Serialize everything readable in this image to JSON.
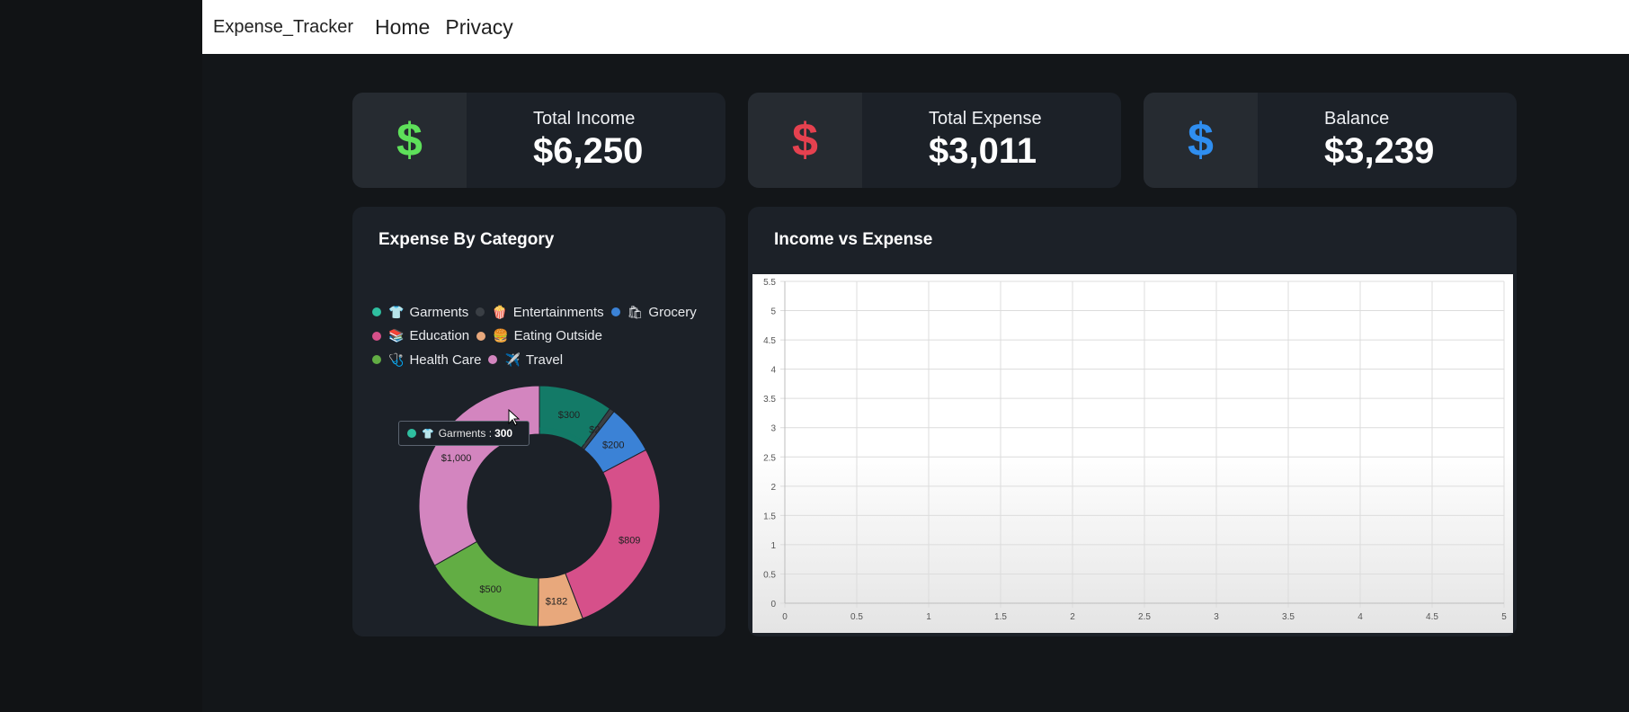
{
  "navbar": {
    "brand": "Expense_Tracker",
    "links": [
      "Home",
      "Privacy"
    ]
  },
  "summary_cards": [
    {
      "label": "Total Income",
      "value": "$6,250",
      "icon": "dollar-icon",
      "color": "#5ee05a"
    },
    {
      "label": "Total Expense",
      "value": "$3,011",
      "icon": "dollar-icon",
      "color": "#e5414f"
    },
    {
      "label": "Balance",
      "value": "$3,239",
      "icon": "dollar-icon",
      "color": "#2f8ef0"
    }
  ],
  "expense_panel": {
    "title": "Expense By Category",
    "legend": [
      {
        "label": "Garments",
        "icon": "👕",
        "color": "#2fbfa0"
      },
      {
        "label": "Entertainments",
        "icon": "🍿",
        "color": "#3a3f45"
      },
      {
        "label": "Grocery",
        "icon": "🛍",
        "color": "#3b82d6"
      },
      {
        "label": "Education",
        "icon": "📚",
        "color": "#d6508a"
      },
      {
        "label": "Eating Outside",
        "icon": "🍔",
        "color": "#e8a87c"
      },
      {
        "label": "Health Care",
        "icon": "🩺",
        "color": "#62ad44"
      },
      {
        "label": "Travel",
        "icon": "✈️",
        "color": "#d385bf"
      }
    ],
    "tooltip": {
      "icon": "👕",
      "label": "Garments :",
      "value": "300"
    }
  },
  "income_panel": {
    "title": "Income vs Expense"
  },
  "chart_data": [
    {
      "type": "pie",
      "title": "Expense By Category",
      "categories": [
        "Garments",
        "Entertainments",
        "Grocery",
        "Education",
        "Eating Outside",
        "Health Care",
        "Travel"
      ],
      "values": [
        300,
        20,
        200,
        809,
        182,
        500,
        1000
      ],
      "data_labels": [
        "$300",
        "$20",
        "$200",
        "$809",
        "$182",
        "$500",
        "$1,000"
      ],
      "colors": [
        "#137a67",
        "#3a3f45",
        "#3b82d6",
        "#d6508a",
        "#e8a87c",
        "#62ad44",
        "#d385bf"
      ],
      "donut": true
    },
    {
      "type": "line",
      "title": "Income vs Expense",
      "series": [],
      "xlim": [
        0,
        5
      ],
      "ylim": [
        0,
        5.5
      ],
      "x_ticks": [
        "0",
        "0.5",
        "1",
        "1.5",
        "2",
        "2.5",
        "3",
        "3.5",
        "4",
        "4.5",
        "5"
      ],
      "y_ticks": [
        "0",
        "0.5",
        "1",
        "1.5",
        "2",
        "2.5",
        "3",
        "3.5",
        "4",
        "4.5",
        "5",
        "5.5"
      ],
      "grid": true
    }
  ]
}
